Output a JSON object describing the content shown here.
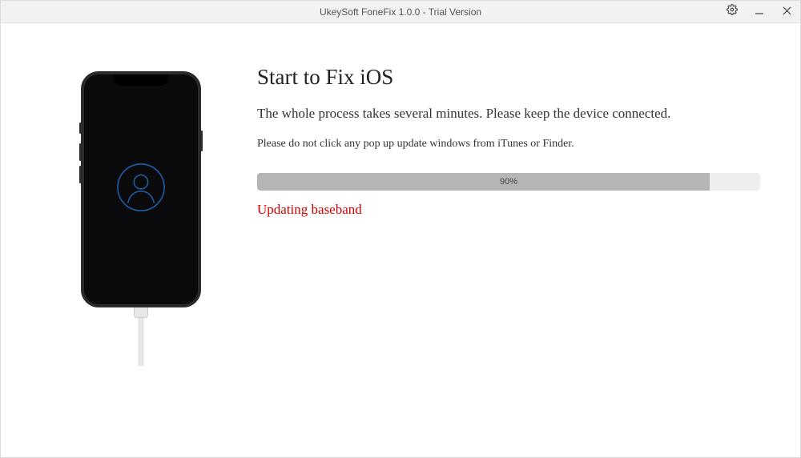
{
  "titlebar": {
    "title": "UkeySoft FoneFix 1.0.0 - Trial Version"
  },
  "main": {
    "heading": "Start to Fix iOS",
    "subheading": "The whole process takes several minutes. Please keep the device connected.",
    "warning": "Please do not click any pop up update windows from iTunes or Finder.",
    "progress_percent": 90,
    "progress_label": "90%",
    "status": "Updating baseband"
  },
  "colors": {
    "status_red": "#d60000",
    "person_stroke": "#1f5fa8"
  }
}
